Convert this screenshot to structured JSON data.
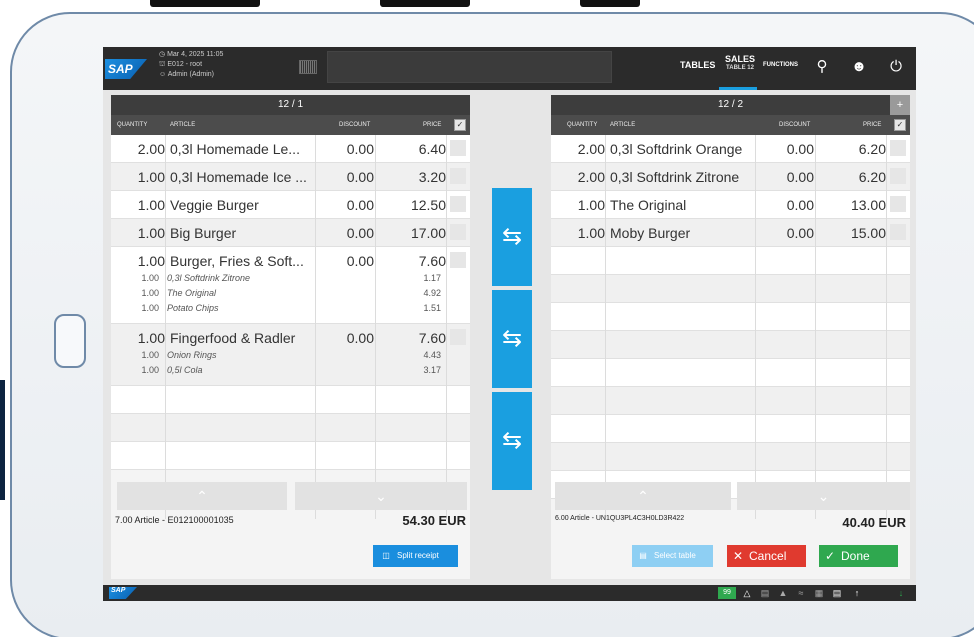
{
  "header": {
    "logo_text": "SAP",
    "datetime": "Mar 4, 2025 11:05",
    "store": "E012 - root",
    "user": "Admin (Admin)",
    "nav": {
      "tables": "TABLES",
      "sales": "SALES",
      "sales_sub": "TABLE 12",
      "functions": "FUNCTIONS"
    }
  },
  "columns": {
    "quantity": "QUANTITY",
    "article": "ARTICLE",
    "discount": "DISCOUNT",
    "price": "PRICE"
  },
  "left": {
    "title": "12 / 1",
    "rows": [
      {
        "qty": "2.00",
        "article": "0,3l Homemade Le...",
        "discount": "0.00",
        "price": "6.40"
      },
      {
        "qty": "1.00",
        "article": "0,3l Homemade Ice ...",
        "discount": "0.00",
        "price": "3.20"
      },
      {
        "qty": "1.00",
        "article": "Veggie Burger",
        "discount": "0.00",
        "price": "12.50"
      },
      {
        "qty": "1.00",
        "article": "Big Burger",
        "discount": "0.00",
        "price": "17.00"
      },
      {
        "qty": "1.00",
        "article": "Burger, Fries & Soft...",
        "discount": "0.00",
        "price": "7.60",
        "subs": [
          {
            "qty": "1.00",
            "article": "0,3l Softdrink Zitrone",
            "price": "1.17"
          },
          {
            "qty": "1.00",
            "article": "The Original",
            "price": "4.92"
          },
          {
            "qty": "1.00",
            "article": "Potato Chips",
            "price": "1.51"
          }
        ]
      },
      {
        "qty": "1.00",
        "article": "Fingerfood & Radler",
        "discount": "0.00",
        "price": "7.60",
        "subs": [
          {
            "qty": "1.00",
            "article": "Onion Rings",
            "price": "4.43"
          },
          {
            "qty": "1.00",
            "article": "0,5l Cola",
            "price": "3.17"
          }
        ]
      }
    ],
    "footer_info": "7.00 Article - E012100001035",
    "total": "54.30 EUR",
    "split_label": "Split receipt"
  },
  "right": {
    "title": "12 / 2",
    "plus": "+",
    "rows": [
      {
        "qty": "2.00",
        "article": "0,3l Softdrink Orange",
        "discount": "0.00",
        "price": "6.20"
      },
      {
        "qty": "2.00",
        "article": "0,3l Softdrink Zitrone",
        "discount": "0.00",
        "price": "6.20"
      },
      {
        "qty": "1.00",
        "article": "The Original",
        "discount": "0.00",
        "price": "13.00"
      },
      {
        "qty": "1.00",
        "article": "Moby Burger",
        "discount": "0.00",
        "price": "15.00"
      }
    ],
    "footer_info": "6.00 Article - UN1QU3PL4C3H0LD3R422",
    "total": "40.40 EUR",
    "select_table_label": "Select table",
    "cancel_label": "Cancel",
    "done_label": "Done"
  },
  "statusbar": {
    "logo_text": "SAP",
    "badge": "99"
  },
  "colors": {
    "accent": "#1a9fe0",
    "cancel": "#e03a2f",
    "done": "#2fa84f",
    "header": "#2b2b2b"
  }
}
